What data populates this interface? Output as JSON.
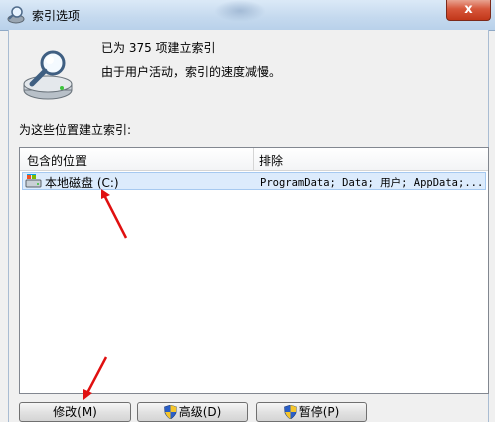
{
  "window": {
    "title": "索引选项",
    "close_glyph": "x"
  },
  "status": {
    "count_text": "已为 375 项建立索引",
    "message": "由于用户活动，索引的速度减慢。"
  },
  "section_label": "为这些位置建立索引:",
  "list": {
    "headers": [
      "包含的位置",
      "排除"
    ],
    "rows": [
      {
        "name": "本地磁盘 (C:)",
        "excluded": "ProgramData; Data; 用户; AppData;..."
      }
    ]
  },
  "buttons": {
    "modify": "修改(M)",
    "advanced": "高级(D)",
    "pause": "暂停(P)"
  },
  "colors": {
    "annotation_arrow": "#e01010",
    "selection": "#dcebfc",
    "titlebar": "#c4d9ee"
  },
  "icons": [
    "magnifier-drive-icon",
    "drive-icon",
    "uac-shield-icon",
    "close-icon"
  ]
}
